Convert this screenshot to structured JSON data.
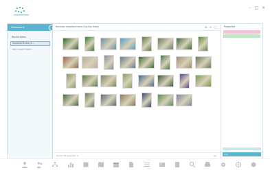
{
  "window": {
    "controls": [
      "–",
      "□",
      "×"
    ]
  },
  "sidebar": {
    "header": "Dashboard",
    "items": [
      {
        "label": "Recent Items",
        "selected": false
      },
      {
        "label": "Imported Items (1...",
        "selected": true
      },
      {
        "label": "Last import folder...",
        "selected": false
      }
    ]
  },
  "main": {
    "header": "Recently Imported Items (Sort by Date)",
    "header_controls": [
      "⊕",
      "≡",
      "▢"
    ],
    "footer_left": "Items: 25   Selected: 0",
    "footer_right": "◂ ▸",
    "photos": [
      {
        "c": "#2f6b2a"
      },
      {
        "c": "#3d7c3a"
      },
      {
        "c": "#6b8fa0"
      },
      {
        "c": "#4fa0c8"
      },
      {
        "c": "#5b7a4a"
      },
      {
        "c": "#6a8060"
      },
      {
        "c": "#3a6a3a"
      },
      {
        "c": "#5a8c3a"
      },
      {
        "c": "#9a6a4a"
      },
      {
        "c": "#b8b0a0"
      },
      {
        "c": "#8a90a0"
      },
      {
        "c": "#6a7a8a"
      },
      {
        "c": "#3e6e36"
      },
      {
        "c": "#4a7a4a"
      },
      {
        "c": "#a09070"
      },
      {
        "c": "#6a7a5a"
      },
      {
        "c": "#8a9a6a"
      },
      {
        "c": "#5a7a4a"
      },
      {
        "c": "#7a8a5a"
      },
      {
        "c": "#8aa060"
      },
      {
        "c": "#4a6a8a"
      },
      {
        "c": "#3a5a3a"
      },
      {
        "c": "#5a4a8a"
      },
      {
        "c": "#7a9a4a"
      },
      {
        "c": "#4a6a4a"
      },
      {
        "c": "#6a7a6a"
      },
      {
        "c": "#5a6a7a"
      },
      {
        "c": "#8a7a5a"
      },
      {
        "c": "#3a4a6a"
      },
      {
        "c": "#5a8a5a"
      },
      {
        "c": "#7a8a9a"
      }
    ]
  },
  "rightpanel": {
    "header": "Properties",
    "bottom_label": "Info"
  },
  "toolbar": {
    "tools": [
      {
        "icon": "person-icon",
        "label": ""
      },
      {
        "icon": "people-icon",
        "label": ""
      },
      {
        "icon": "tree-icon",
        "label": ""
      },
      {
        "icon": "chart-icon",
        "label": ""
      },
      {
        "icon": "book-icon",
        "label": ""
      },
      {
        "icon": "map-icon",
        "label": ""
      },
      {
        "icon": "calendar-icon",
        "label": ""
      },
      {
        "icon": "document-icon",
        "label": ""
      },
      {
        "icon": "list-icon",
        "label": ""
      },
      {
        "icon": "photo-icon",
        "label": ""
      },
      {
        "icon": "source-icon",
        "label": ""
      },
      {
        "icon": "search-icon",
        "label": ""
      },
      {
        "icon": "print-icon",
        "label": ""
      },
      {
        "icon": "settings-icon",
        "label": ""
      },
      {
        "icon": "web-icon",
        "label": ""
      },
      {
        "icon": "help-icon",
        "label": ""
      }
    ]
  },
  "colors": {
    "accent": "#5bb5d0",
    "panel_border": "#d6e3ea"
  }
}
